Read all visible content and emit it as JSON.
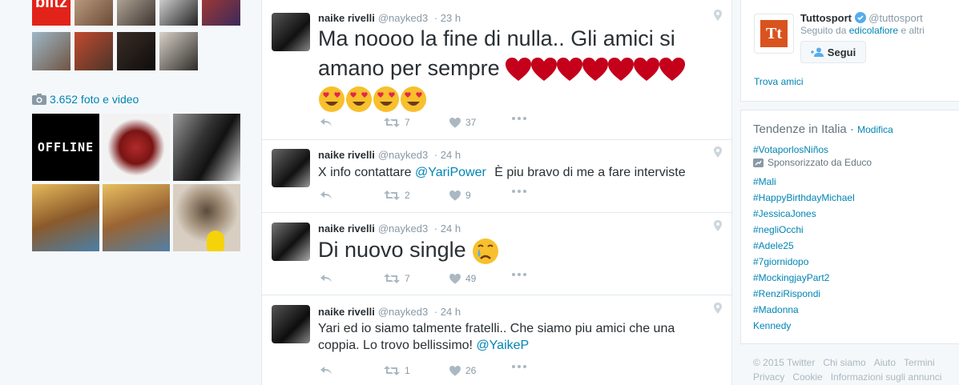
{
  "left": {
    "photo_count_label": "3.652 foto e video",
    "thumb_logo_text": "blitz",
    "tile_offline_text": "OFFLINE"
  },
  "tweets": [
    {
      "name": "naike rivelli",
      "handle": "@nayked3",
      "time": "23 h",
      "text": "Ma noooo la fine di nulla.. Gli amici si amano per sempre",
      "retweets": "7",
      "likes": "37"
    },
    {
      "name": "naike rivelli",
      "handle": "@nayked3",
      "time": "24 h",
      "text_before": "X info contattare",
      "mention": "@YariPower",
      "text_after": "È piu bravo di me a fare interviste",
      "retweets": "2",
      "likes": "9"
    },
    {
      "name": "naike rivelli",
      "handle": "@nayked3",
      "time": "24 h",
      "text": "Di nuovo single",
      "retweets": "7",
      "likes": "49"
    },
    {
      "name": "naike rivelli",
      "handle": "@nayked3",
      "time": "24 h",
      "text_line1": "Yari ed io siamo talmente fratelli.. Che siamo piu amici che una",
      "text_line2": "coppia. Lo trovo bellissimo!",
      "mention": "@YaikeP",
      "retweets": "1",
      "likes": "26"
    }
  ],
  "who_to_follow": {
    "name": "Tuttosport",
    "handle": "@tuttosport",
    "followed_by_prefix": "Seguito da",
    "followed_by_user": "edicolafiore",
    "followed_by_suffix": "e altri",
    "follow_label": "Segui",
    "find_friends": "Trova amici",
    "logo_text": "Tt"
  },
  "trends": {
    "title": "Tendenze in Italia",
    "change_label": "Modifica",
    "promoted_tag": "#VotaporlosNiños",
    "promoted_label": "Sponsorizzato da Educo",
    "items": [
      "#Mali",
      "#HappyBirthdayMichael",
      "#JessicaJones",
      "#negliOcchi",
      "#Adele25",
      "#7giornidopo",
      "#MockingjayPart2",
      "#RenziRispondi",
      "#Madonna",
      "Kennedy"
    ]
  },
  "footer": {
    "row1": [
      "© 2015 Twitter",
      "Chi siamo",
      "Aiuto",
      "Termini"
    ],
    "row2": [
      "Privacy",
      "Cookie",
      "Informazioni sugli annunci"
    ]
  },
  "colors": {
    "link": "#0084b4",
    "heart": "#c4001b",
    "meta": "#8899a6"
  }
}
